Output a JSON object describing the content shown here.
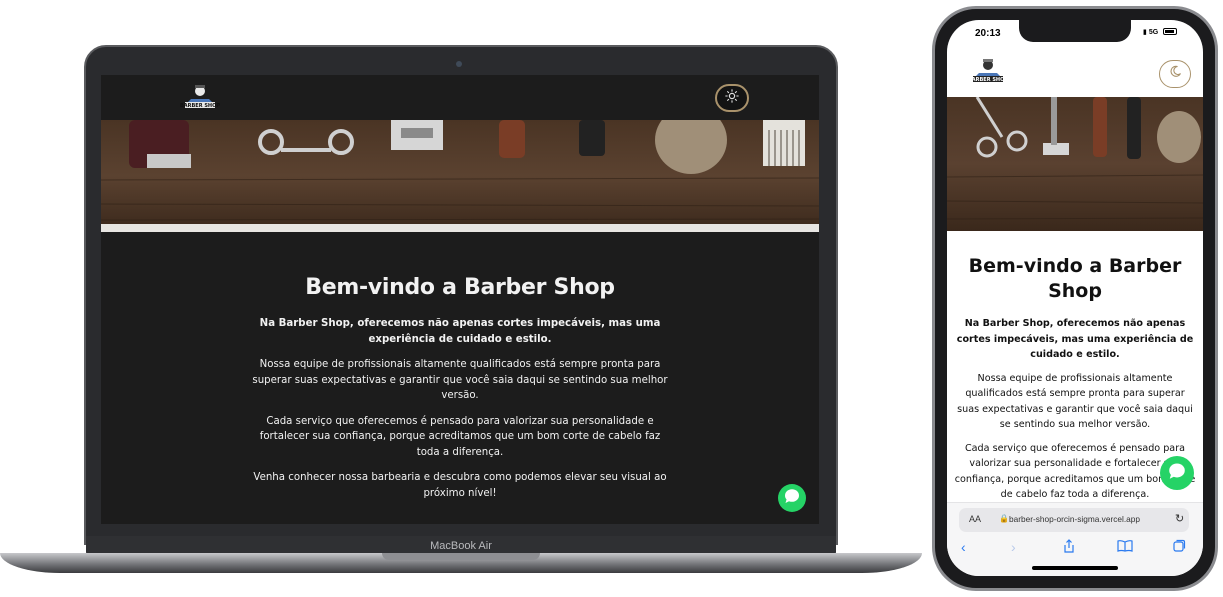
{
  "laptop": {
    "model_label": "MacBook Air",
    "site": {
      "logo_text": "BARBER SHOP",
      "theme_toggle_icon": "sun-icon",
      "title": "Bem-vindo a Barber Shop",
      "intro_bold": "Na Barber Shop, oferecemos não apenas cortes impecáveis, mas uma experiência de cuidado e estilo.",
      "paragraph_1": "Nossa equipe de profissionais altamente qualificados está sempre pronta para superar suas expectativas e garantir que você saia daqui se sentindo sua melhor versão.",
      "paragraph_2": "Cada serviço que oferecemos é pensado para valorizar sua personalidade e fortalecer sua confiança, porque acreditamos que um bom corte de cabelo faz toda a diferença.",
      "paragraph_3": "Venha conhecer nossa barbearia e descubra como podemos elevar seu visual ao próximo nível!",
      "chat_icon": "whatsapp-chat-icon"
    }
  },
  "phone": {
    "status_time": "20:13",
    "status_network": "5G",
    "site": {
      "logo_text": "BARBER SHOP",
      "theme_toggle_icon": "moon-icon",
      "title": "Bem-vindo a Barber Shop",
      "intro_bold": "Na Barber Shop, oferecemos não apenas cortes impecáveis, mas uma experiência de cuidado e estilo.",
      "paragraph_1": "Nossa equipe de profissionais altamente qualificados está sempre pronta para superar suas expectativas e garantir que você saia daqui se sentindo sua melhor versão.",
      "paragraph_2": "Cada serviço que oferecemos é pensado para valorizar sua personalidade e fortalecer sua confiança, porque acreditamos que um bom corte de cabelo faz toda a diferença.",
      "chat_icon": "whatsapp-chat-icon"
    },
    "browser": {
      "aa_label": "AA",
      "url": "barber-shop-orcin-sigma.vercel.app",
      "reload_icon": "reload-icon",
      "nav_icons": [
        "back-icon",
        "forward-icon",
        "share-icon",
        "bookmarks-icon",
        "tabs-icon"
      ]
    }
  },
  "colors": {
    "accent_gold": "#a9926b",
    "dark_bg": "#1c1c1c",
    "whatsapp_green": "#25d366"
  }
}
